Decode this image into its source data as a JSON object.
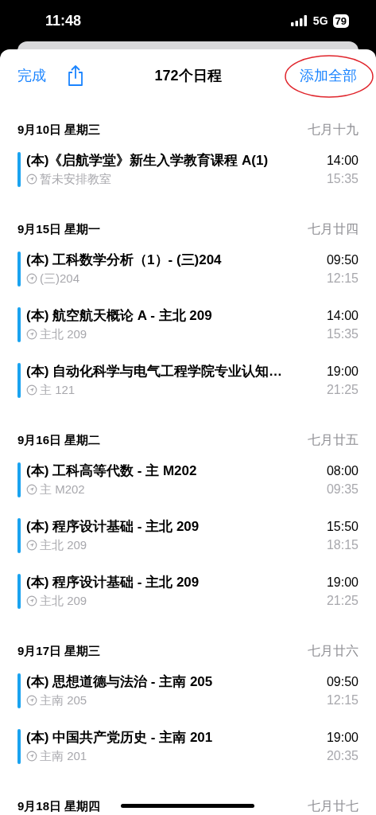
{
  "status_bar": {
    "time": "11:48",
    "network": "5G",
    "battery": "79"
  },
  "header": {
    "done": "完成",
    "title": "172个日程",
    "add_all": "添加全部",
    "add_all_circled": true
  },
  "days": [
    {
      "date": "9月10日 星期三",
      "lunar": "七月十九",
      "events": [
        {
          "title": "(本)《启航学堂》新生入学教育课程 A(1)",
          "location": "暂未安排教室",
          "start": "14:00",
          "end": "15:35"
        }
      ]
    },
    {
      "date": "9月15日 星期一",
      "lunar": "七月廿四",
      "events": [
        {
          "title": "(本) 工科数学分析（1）- (三)204",
          "location": "(三)204",
          "start": "09:50",
          "end": "12:15"
        },
        {
          "title": "(本) 航空航天概论 A - 主北 209",
          "location": "主北 209",
          "start": "14:00",
          "end": "15:35"
        },
        {
          "title": "(本) 自动化科学与电气工程学院专业认知…",
          "location": "主 121",
          "start": "19:00",
          "end": "21:25"
        }
      ]
    },
    {
      "date": "9月16日 星期二",
      "lunar": "七月廿五",
      "events": [
        {
          "title": "(本) 工科高等代数 - 主 M202",
          "location": "主 M202",
          "start": "08:00",
          "end": "09:35"
        },
        {
          "title": "(本) 程序设计基础 - 主北 209",
          "location": "主北 209",
          "start": "15:50",
          "end": "18:15"
        },
        {
          "title": "(本) 程序设计基础 - 主北 209",
          "location": "主北 209",
          "start": "19:00",
          "end": "21:25"
        }
      ]
    },
    {
      "date": "9月17日 星期三",
      "lunar": "七月廿六",
      "events": [
        {
          "title": "(本) 思想道德与法治 - 主南 205",
          "location": "主南 205",
          "start": "09:50",
          "end": "12:15"
        },
        {
          "title": "(本) 中国共产党历史 - 主南 201",
          "location": "主南 201",
          "start": "19:00",
          "end": "20:35"
        }
      ]
    },
    {
      "date": "9月18日 星期四",
      "lunar": "七月廿七"
    }
  ]
}
